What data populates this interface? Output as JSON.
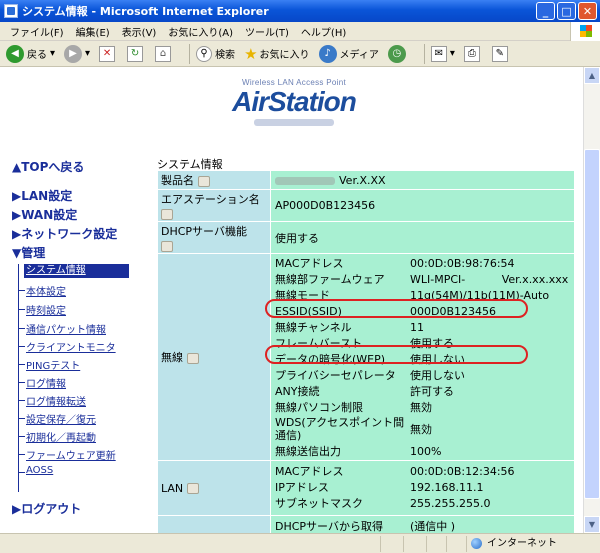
{
  "window": {
    "title": "システム情報 - Microsoft Internet Explorer"
  },
  "menu": [
    "ファイル(F)",
    "編集(E)",
    "表示(V)",
    "お気に入り(A)",
    "ツール(T)",
    "ヘルプ(H)"
  ],
  "toolbar": {
    "back": "戻る",
    "search": "検索",
    "favorites": "お気に入り",
    "media": "メディア"
  },
  "status": {
    "zone": "インターネット"
  },
  "logo": {
    "tagline": "Wireless LAN Access Point",
    "name": "AirStation"
  },
  "nav": {
    "top": "▲TOPへ戻る",
    "lan": "▶LAN設定",
    "wan": "▶WAN設定",
    "network": "▶ネットワーク設定",
    "admin": "▼管理",
    "items": [
      "システム情報",
      "本体設定",
      "時刻設定",
      "通信パケット情報",
      "クライアントモニタ",
      "PINGテスト",
      "ログ情報",
      "ログ情報転送",
      "設定保存／復元",
      "初期化／再起動",
      "ファームウェア更新",
      "AOSS"
    ],
    "logout": "▶ログアウト"
  },
  "page": {
    "title": "システム情報"
  },
  "info": {
    "product_label": "製品名",
    "product_value": "Ver.X.XX",
    "station_label": "エアステーション名",
    "station_value": "AP000D0B123456",
    "dhcp_label": "DHCPサーバ機能",
    "dhcp_value": "使用する",
    "wireless_label": "無線",
    "wireless": [
      {
        "k": "MACアドレス",
        "v": "00:0D:0B:98:76:54"
      },
      {
        "k": "無線部ファームウェア",
        "v": "WLI-MPCI-　　　 Ver.x.xx.xxx"
      },
      {
        "k": "無線モード",
        "v": "11g(54M)/11b(11M)-Auto"
      },
      {
        "k": "ESSID(SSID)",
        "v": "000D0B123456"
      },
      {
        "k": "無線チャンネル",
        "v": "11"
      },
      {
        "k": "フレームバースト",
        "v": "使用する"
      },
      {
        "k": "データの暗号化(WEP)",
        "v": "使用しない"
      },
      {
        "k": "プライバシーセパレータ",
        "v": "使用しない"
      },
      {
        "k": "ANY接続",
        "v": "許可する"
      },
      {
        "k": "無線パソコン制限",
        "v": "無効"
      },
      {
        "k": "WDS(アクセスポイント間通信)",
        "v": "無効"
      },
      {
        "k": "無線送信出力",
        "v": "100%"
      }
    ],
    "lan_label": "LAN",
    "lan": [
      {
        "k": "MACアドレス",
        "v": "00:0D:0B:12:34:56"
      },
      {
        "k": "IPアドレス",
        "v": "192.168.11.1"
      },
      {
        "k": "サブネットマスク",
        "v": "255.255.255.0"
      }
    ],
    "last": {
      "k": "DHCPサーバから取得",
      "v": "(通信中 )"
    }
  }
}
